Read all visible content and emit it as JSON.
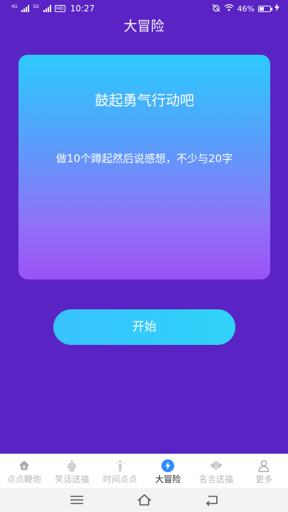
{
  "status_bar": {
    "net1": "4G",
    "net2": "5G",
    "hd": "HD",
    "time": "10:27",
    "battery": "46%",
    "battery_level": 0.46
  },
  "header": {
    "title": "大冒险"
  },
  "card": {
    "title": "鼓起勇气行动吧",
    "text": "做10个蹲起然后说感想，不少与20字"
  },
  "start_button": {
    "label": "开始"
  },
  "bottom_nav": {
    "items": [
      {
        "label": "点点鞭炮",
        "icon": "firecracker-icon",
        "active": false
      },
      {
        "label": "笑话送福",
        "icon": "lantern-icon",
        "active": false
      },
      {
        "label": "时间点点",
        "icon": "sparkler-icon",
        "active": false
      },
      {
        "label": "大冒险",
        "icon": "lightning-icon",
        "active": true
      },
      {
        "label": "名言送福",
        "icon": "bowl-icon",
        "active": false
      },
      {
        "label": "更多",
        "icon": "person-icon",
        "active": false
      }
    ]
  },
  "colors": {
    "background": "#5a24c4",
    "active_accent": "#2f8cff",
    "button": "#33c8fc"
  }
}
